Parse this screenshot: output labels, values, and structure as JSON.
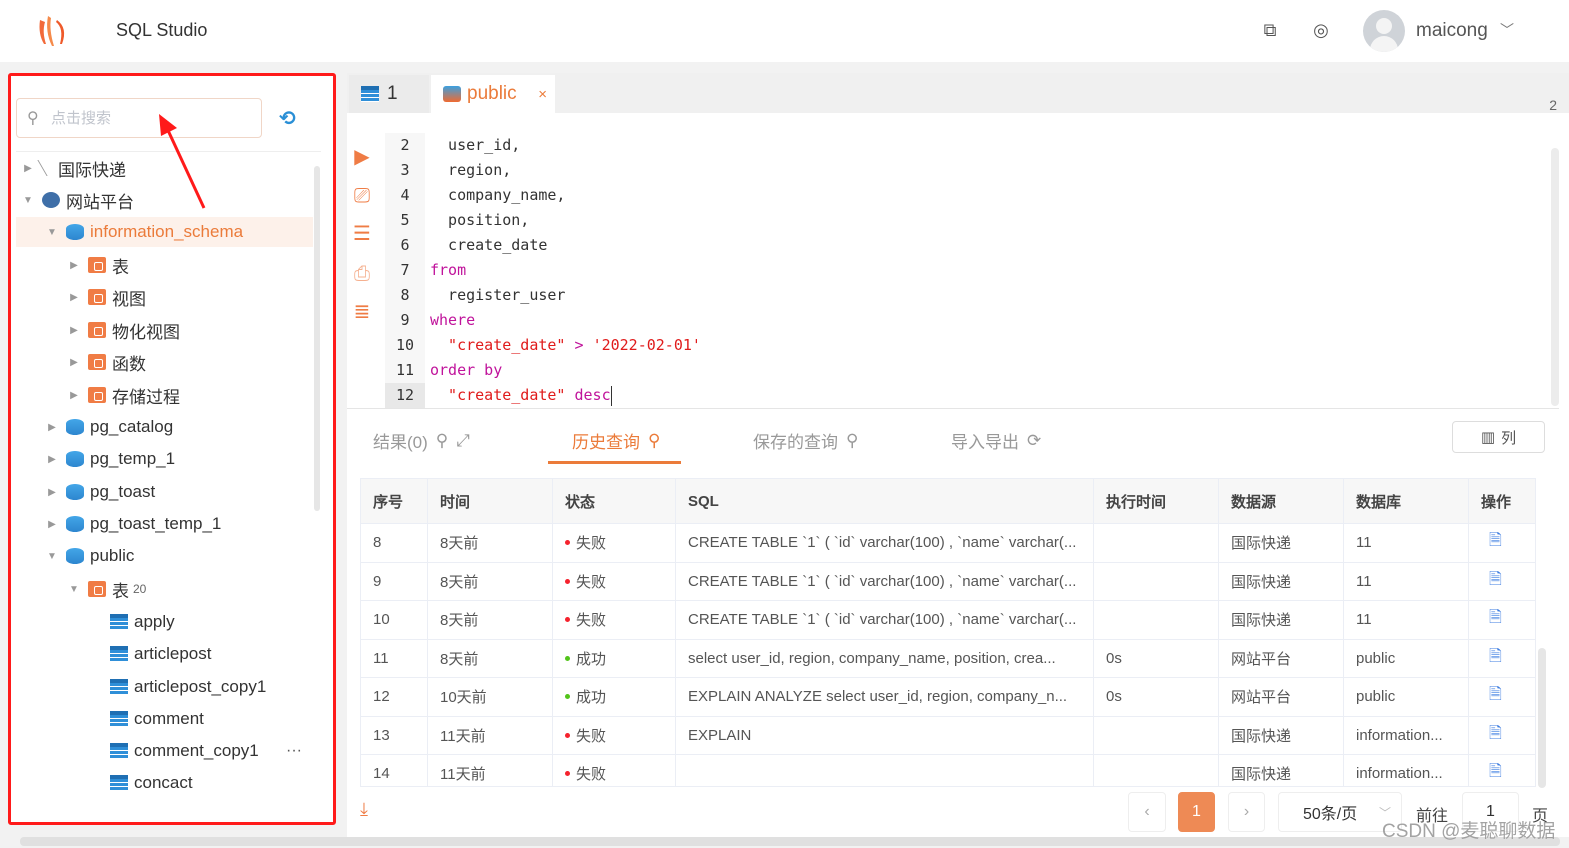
{
  "header": {
    "title": "SQL Studio",
    "user": "maicong",
    "icons": [
      "translate-icon",
      "settings-icon"
    ]
  },
  "sidebar": {
    "search_placeholder": "点击搜索",
    "tree": [
      {
        "label": "国际快递",
        "level": 0,
        "icon": "network",
        "expanded": false
      },
      {
        "label": "网站平台",
        "level": 0,
        "icon": "postgres",
        "expanded": true
      },
      {
        "label": "information_schema",
        "level": 1,
        "icon": "db",
        "expanded": true,
        "selected": true
      },
      {
        "label": "表",
        "level": 2,
        "icon": "folder",
        "expanded": false
      },
      {
        "label": "视图",
        "level": 2,
        "icon": "folder",
        "expanded": false
      },
      {
        "label": "物化视图",
        "level": 2,
        "icon": "folder",
        "expanded": false
      },
      {
        "label": "函数",
        "level": 2,
        "icon": "folder",
        "expanded": false
      },
      {
        "label": "存储过程",
        "level": 2,
        "icon": "folder",
        "expanded": false
      },
      {
        "label": "pg_catalog",
        "level": 1,
        "icon": "db",
        "expanded": false
      },
      {
        "label": "pg_temp_1",
        "level": 1,
        "icon": "db",
        "expanded": false
      },
      {
        "label": "pg_toast",
        "level": 1,
        "icon": "db",
        "expanded": false
      },
      {
        "label": "pg_toast_temp_1",
        "level": 1,
        "icon": "db",
        "expanded": false
      },
      {
        "label": "public",
        "level": 1,
        "icon": "db",
        "expanded": true
      },
      {
        "label": "表",
        "badge": "20",
        "level": 2,
        "icon": "folder",
        "expanded": true
      },
      {
        "label": "apply",
        "level": 3,
        "icon": "table"
      },
      {
        "label": "articlepost",
        "level": 3,
        "icon": "table"
      },
      {
        "label": "articlepost_copy1",
        "level": 3,
        "icon": "table"
      },
      {
        "label": "comment",
        "level": 3,
        "icon": "table"
      },
      {
        "label": "comment_copy1",
        "level": 3,
        "icon": "table",
        "more": "···"
      },
      {
        "label": "concact",
        "level": 3,
        "icon": "table"
      }
    ]
  },
  "tabs": [
    {
      "label": "1"
    },
    {
      "label": "public",
      "close": "×"
    }
  ],
  "tab_count": "2",
  "editor": {
    "lines": [
      {
        "n": "2",
        "tokens": [
          [
            "",
            "  user_id,"
          ]
        ]
      },
      {
        "n": "3",
        "tokens": [
          [
            "",
            "  region,"
          ]
        ]
      },
      {
        "n": "4",
        "tokens": [
          [
            "",
            "  company_name,"
          ]
        ]
      },
      {
        "n": "5",
        "tokens": [
          [
            "",
            "  position,"
          ]
        ]
      },
      {
        "n": "6",
        "tokens": [
          [
            "",
            "  create_date"
          ]
        ]
      },
      {
        "n": "7",
        "tokens": [
          [
            "kw",
            "from"
          ]
        ]
      },
      {
        "n": "8",
        "tokens": [
          [
            "",
            "  register_user"
          ]
        ]
      },
      {
        "n": "9",
        "tokens": [
          [
            "kw",
            "where"
          ]
        ]
      },
      {
        "n": "10",
        "tokens": [
          [
            "str",
            "  \"create_date\""
          ],
          [
            "kw",
            " > "
          ],
          [
            "str",
            "'2022-02-01'"
          ]
        ]
      },
      {
        "n": "11",
        "tokens": [
          [
            "kw",
            "order by"
          ]
        ]
      },
      {
        "n": "12",
        "tokens": [
          [
            "str",
            "  \"create_date\""
          ],
          [
            "kw",
            " desc"
          ]
        ],
        "current": true
      }
    ]
  },
  "result_tabs": [
    {
      "label": "结果(0)"
    },
    {
      "label": "历史查询",
      "active": true
    },
    {
      "label": "保存的查询"
    },
    {
      "label": "导入导出"
    }
  ],
  "columns_button": "列",
  "table": {
    "headers": [
      "序号",
      "时间",
      "状态",
      "SQL",
      "执行时间",
      "数据源",
      "数据库",
      "操作"
    ],
    "rows": [
      [
        "8",
        "8天前",
        "失败",
        "CREATE TABLE `1` ( `id` varchar(100) , `name` varchar(...",
        "",
        "国际快递",
        "11"
      ],
      [
        "9",
        "8天前",
        "失败",
        "CREATE TABLE `1` ( `id` varchar(100) , `name` varchar(...",
        "",
        "国际快递",
        "11"
      ],
      [
        "10",
        "8天前",
        "失败",
        "CREATE TABLE `1` ( `id` varchar(100) , `name` varchar(...",
        "",
        "国际快递",
        "11"
      ],
      [
        "11",
        "8天前",
        "成功",
        "select user_id, region, company_name, position, crea...",
        "0s",
        "网站平台",
        "public"
      ],
      [
        "12",
        "10天前",
        "成功",
        "EXPLAIN ANALYZE select user_id, region, company_n...",
        "0s",
        "网站平台",
        "public"
      ],
      [
        "13",
        "11天前",
        "失败",
        "EXPLAIN",
        "",
        "国际快递",
        "information..."
      ],
      [
        "14",
        "11天前",
        "失败",
        "",
        "",
        "国际快递",
        "information..."
      ]
    ]
  },
  "status_colors": {
    "失败": "#f5222d",
    "成功": "#52c41a"
  },
  "pagination": {
    "current": "1",
    "page_size": "50条/页",
    "goto_label": "前往",
    "goto_value": "1",
    "page_suffix": "页"
  },
  "watermark": "CSDN @麦聪聊数据",
  "accent": "#eb7b3a"
}
